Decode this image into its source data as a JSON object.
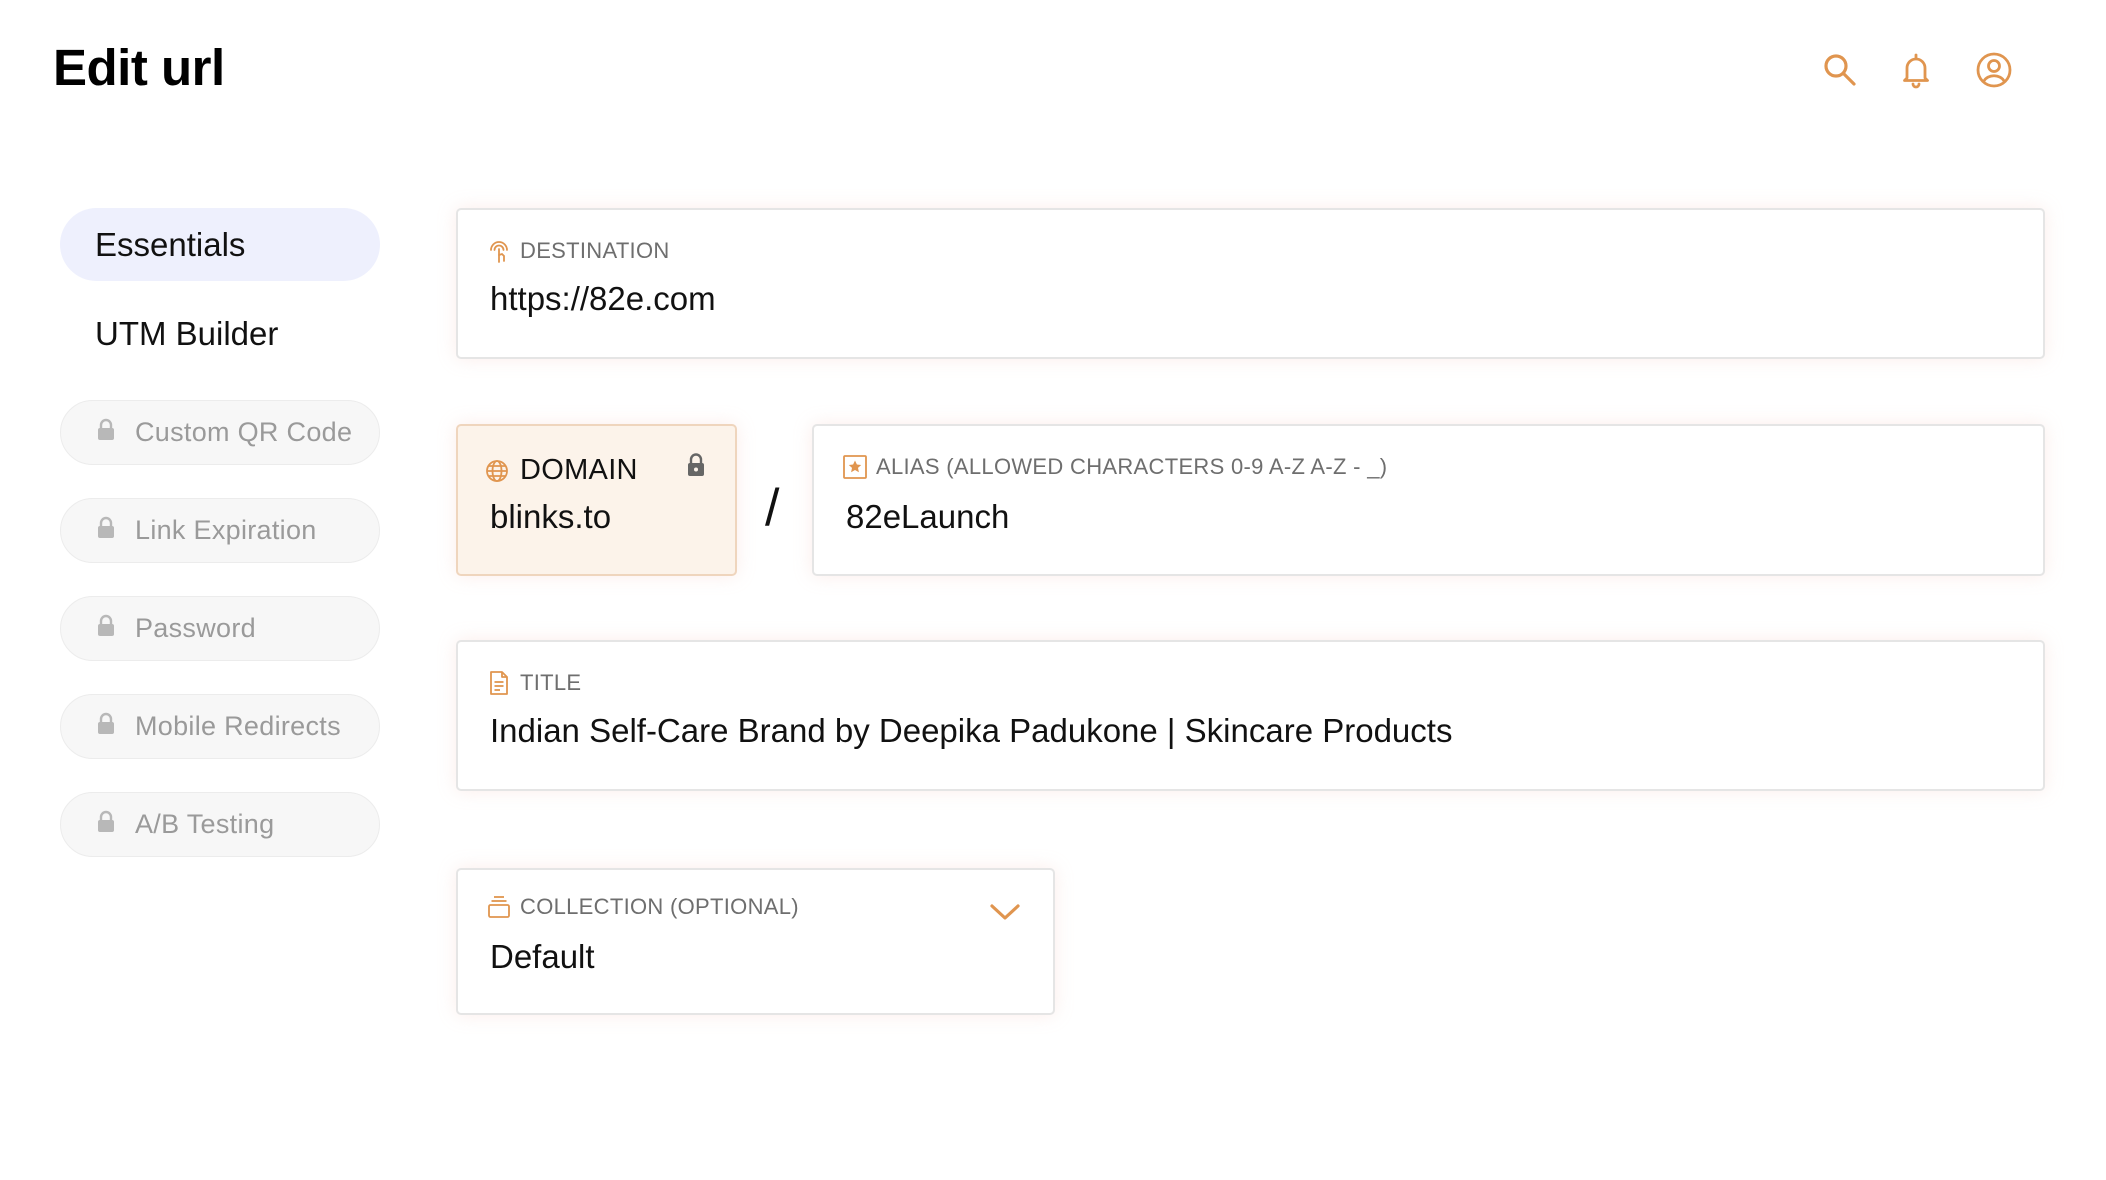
{
  "page": {
    "title": "Edit url"
  },
  "header_icons": [
    "search-icon",
    "bell-icon",
    "user-circle-icon"
  ],
  "colors": {
    "accent": "#e0954f",
    "active_nav_bg": "#eef0fd",
    "domain_bg": "#fcf3ea",
    "locked_text": "#9a9a9a"
  },
  "sidebar": {
    "items": [
      {
        "label": "Essentials",
        "state": "active"
      },
      {
        "label": "UTM Builder",
        "state": "enabled"
      },
      {
        "label": "Custom QR Code",
        "state": "locked"
      },
      {
        "label": "Link Expiration",
        "state": "locked"
      },
      {
        "label": "Password",
        "state": "locked"
      },
      {
        "label": "Mobile Redirects",
        "state": "locked"
      },
      {
        "label": "A/B Testing",
        "state": "locked"
      }
    ]
  },
  "form": {
    "destination": {
      "label": "DESTINATION",
      "value": "https://82e.com",
      "icon": "touch-pointer-icon"
    },
    "domain": {
      "label": "DOMAIN",
      "value": "blinks.to",
      "icon": "globe-icon",
      "locked": true
    },
    "separator": "/",
    "alias": {
      "label": "ALIAS (ALLOWED CHARACTERS 0-9 A-Z A-Z - _)",
      "value": "82eLaunch",
      "icon": "star-box-icon"
    },
    "title": {
      "label": "TITLE",
      "value": "Indian Self-Care Brand by Deepika Padukone | Skincare Products",
      "icon": "document-icon"
    },
    "collection": {
      "label": "COLLECTION (OPTIONAL)",
      "value": "Default",
      "icon": "stack-icon"
    }
  }
}
